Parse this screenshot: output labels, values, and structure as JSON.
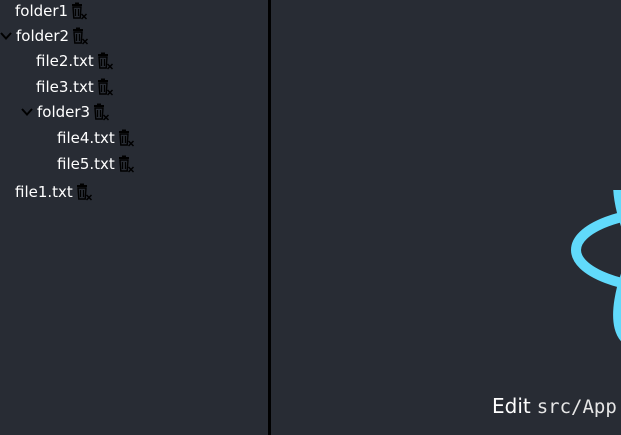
{
  "tree": [
    {
      "label": "folder1",
      "expanded": false,
      "type": "folder"
    },
    {
      "label": "folder2",
      "expanded": true,
      "type": "folder"
    },
    {
      "label": "file2.txt",
      "type": "file"
    },
    {
      "label": "file3.txt",
      "type": "file"
    },
    {
      "label": "folder3",
      "expanded": true,
      "type": "folder"
    },
    {
      "label": "file4.txt",
      "type": "file"
    },
    {
      "label": "file5.txt",
      "type": "file"
    },
    {
      "label": "file1.txt",
      "type": "file"
    }
  ],
  "main": {
    "edit_text": "Edit",
    "edit_path": "src/App"
  },
  "colors": {
    "background": "#282c34",
    "divider": "#000000",
    "logo": "#61dafb",
    "text": "#ffffff"
  },
  "icons": {
    "delete": "trash-x-icon",
    "expand": "chevron-down-icon",
    "logo": "react-logo-icon"
  }
}
